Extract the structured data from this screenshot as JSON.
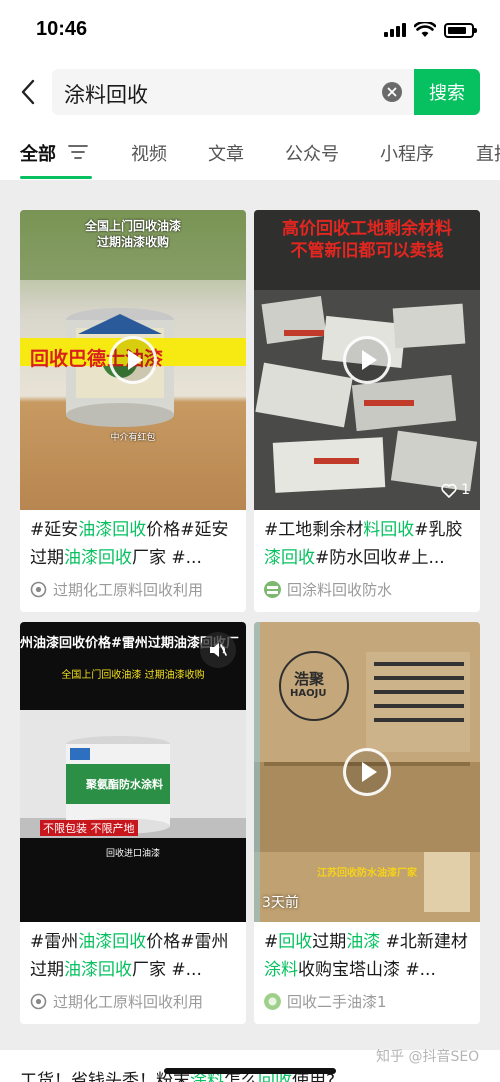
{
  "status_bar": {
    "time": "10:46"
  },
  "search": {
    "query": "涂料回收",
    "button_label": "搜索"
  },
  "tabs": [
    {
      "label": "全部"
    },
    {
      "label": "视频"
    },
    {
      "label": "文章"
    },
    {
      "label": "公众号"
    },
    {
      "label": "小程序"
    },
    {
      "label": "直拍"
    }
  ],
  "cards": [
    {
      "overlay_top": "全国上门回收油漆",
      "overlay_top2": "过期油漆收购",
      "overlay_mid": "回收巴德士油漆",
      "overlay_bottom": "中介有红包",
      "title_parts": [
        "#延安",
        "油漆",
        "回收",
        "价格#延安过期",
        "油漆",
        "回收",
        "厂家 #..."
      ],
      "source": "过期化工原料回收利用",
      "icon": "account-icon"
    },
    {
      "overlay_top": "高价回收工地剩余材料",
      "overlay_top2": "不管新旧都可以卖钱",
      "title_parts": [
        "#工地剩余材",
        "料",
        "回收",
        "#乳胶",
        "漆",
        "回收",
        "#防水回收#上..."
      ],
      "source": "回涂料回收防水",
      "like_count": "1",
      "icon": "heart-icon"
    },
    {
      "overlay_banner": "州油漆回收价格#雷州过期油漆回收厂",
      "overlay_yellow": "全国上门回收油漆  过期油漆收购",
      "overlay_label": "聚氨酯防水涂料",
      "overlay_red": "不限包装 不限产地",
      "overlay_bottom": "回收进口油漆",
      "title_parts": [
        "#雷州",
        "油漆",
        "回收",
        "价格#雷州过期",
        "油漆",
        "回收",
        "厂家 #..."
      ],
      "source": "过期化工原料回收利用",
      "icon": "mute-icon"
    },
    {
      "overlay_box1": "浩聚",
      "overlay_box2": "HAOJU",
      "overlay_bottom": "江苏回收防水油漆厂家",
      "title_parts": [
        "#",
        "回收",
        "过期",
        "油漆",
        " #北新建材",
        "涂料",
        "收购宝塔山漆 #..."
      ],
      "source": "回收二手油漆1",
      "time_badge": "3天前",
      "icon": "play-icon"
    }
  ],
  "bottom": {
    "text_parts": [
      "工货！省钱头秃！粉末",
      "涂料",
      "怎么",
      "回收",
      "使用?"
    ]
  },
  "watermark": "知乎 @抖音SEO"
}
